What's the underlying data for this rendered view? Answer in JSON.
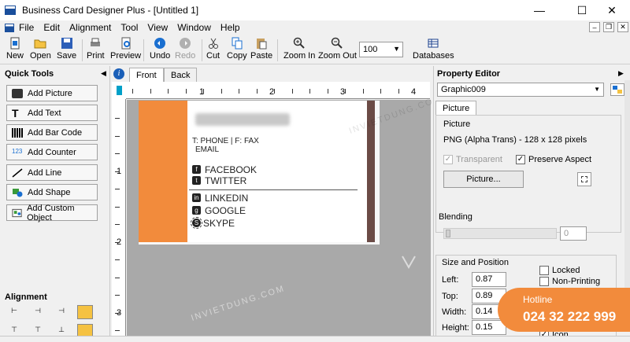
{
  "window": {
    "title": "Business Card Designer Plus - [Untitled 1]"
  },
  "menu": [
    "File",
    "Edit",
    "Alignment",
    "Tool",
    "View",
    "Window",
    "Help"
  ],
  "toolbar": {
    "new": "New",
    "open": "Open",
    "save": "Save",
    "print": "Print",
    "preview": "Preview",
    "undo": "Undo",
    "redo": "Redo",
    "cut": "Cut",
    "copy": "Copy",
    "paste": "Paste",
    "zoom_in": "Zoom In",
    "zoom_out": "Zoom Out",
    "zoom_value": "100",
    "databases": "Databases"
  },
  "quick_tools": {
    "title": "Quick Tools",
    "buttons": [
      "Add Picture",
      "Add Text",
      "Add Bar Code",
      "Add Counter",
      "Add Line",
      "Add Shape",
      "Add Custom Object"
    ],
    "alignment_title": "Alignment"
  },
  "canvas": {
    "tabs": [
      "Front",
      "Back"
    ],
    "ruler_top": [
      "1",
      "2",
      "3",
      "4"
    ],
    "ruler_left": [
      "1",
      "2",
      "3"
    ],
    "card": {
      "contact_line": "T: PHONE  |  F: FAX",
      "email": "EMAIL",
      "social": [
        "FACEBOOK",
        "TWITTER",
        "LINKEDIN",
        "GOOGLE",
        "SKYPE"
      ],
      "colors": {
        "accent": "#f28b3c",
        "side_bar": "#6b4b46"
      }
    },
    "watermarks": [
      "INVIETDUNG.COM",
      "INVIETDUNG.COM"
    ]
  },
  "property_editor": {
    "title": "Property Editor",
    "selected_object": "Graphic009",
    "tab": "Picture",
    "picture_group": "Picture",
    "picture_info": "PNG (Alpha Trans) - 128 x 128 pixels",
    "transparent_label": "Transparent",
    "preserve_aspect_label": "Preserve Aspect",
    "picture_button": "Picture...",
    "blending_label": "Blending",
    "blending_value": "0",
    "size_position_group": "Size and Position",
    "left_label": "Left:",
    "left_value": "0.87",
    "top_label": "Top:",
    "top_value": "0.89",
    "width_label": "Width:",
    "width_value": "0.14",
    "height_label": "Height:",
    "height_value": "0.15",
    "locked_label": "Locked",
    "non_printing_label": "Non-Printing",
    "icon_label": "Icon"
  },
  "hotline": {
    "label": "Hotline",
    "number": "024 32 222 999"
  }
}
